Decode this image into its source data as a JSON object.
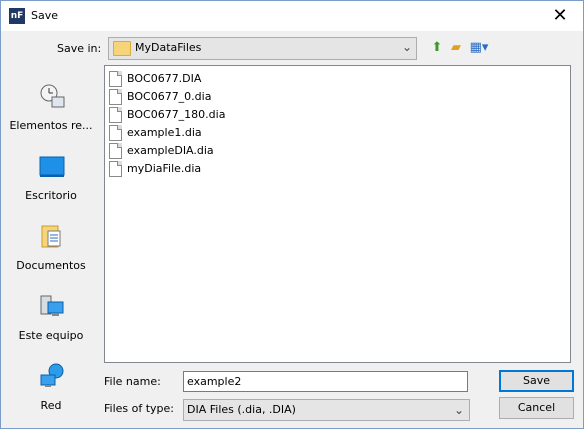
{
  "window": {
    "title": "Save",
    "app_icon_text": "nF"
  },
  "save_in": {
    "label": "Save in:",
    "value": "MyDataFiles"
  },
  "places": [
    {
      "label": "Elementos re..."
    },
    {
      "label": "Escritorio"
    },
    {
      "label": "Documentos"
    },
    {
      "label": "Este equipo"
    },
    {
      "label": "Red"
    }
  ],
  "files": [
    {
      "name": "BOC0677.DIA"
    },
    {
      "name": "BOC0677_0.dia"
    },
    {
      "name": "BOC0677_180.dia"
    },
    {
      "name": "example1.dia"
    },
    {
      "name": "exampleDIA.dia"
    },
    {
      "name": "myDiaFile.dia"
    }
  ],
  "file_name": {
    "label": "File name:",
    "value": "example2"
  },
  "file_type": {
    "label": "Files of type:",
    "value": "DIA Files (.dia, .DIA)"
  },
  "buttons": {
    "save": "Save",
    "cancel": "Cancel"
  }
}
